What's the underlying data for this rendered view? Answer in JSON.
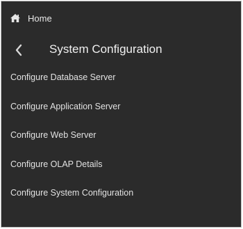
{
  "nav": {
    "home_label": "Home",
    "home_icon": "home-icon",
    "back_icon": "chevron-left-icon"
  },
  "header": {
    "title": "System Configuration"
  },
  "menu": {
    "items": [
      {
        "label": "Configure Database Server"
      },
      {
        "label": "Configure Application Server"
      },
      {
        "label": "Configure Web Server"
      },
      {
        "label": "Configure OLAP Details"
      },
      {
        "label": "Configure System Configuration"
      }
    ]
  },
  "colors": {
    "panel_background": "#2b2b2b",
    "text": "#e6e6e6",
    "border": "#bdbdbd"
  }
}
